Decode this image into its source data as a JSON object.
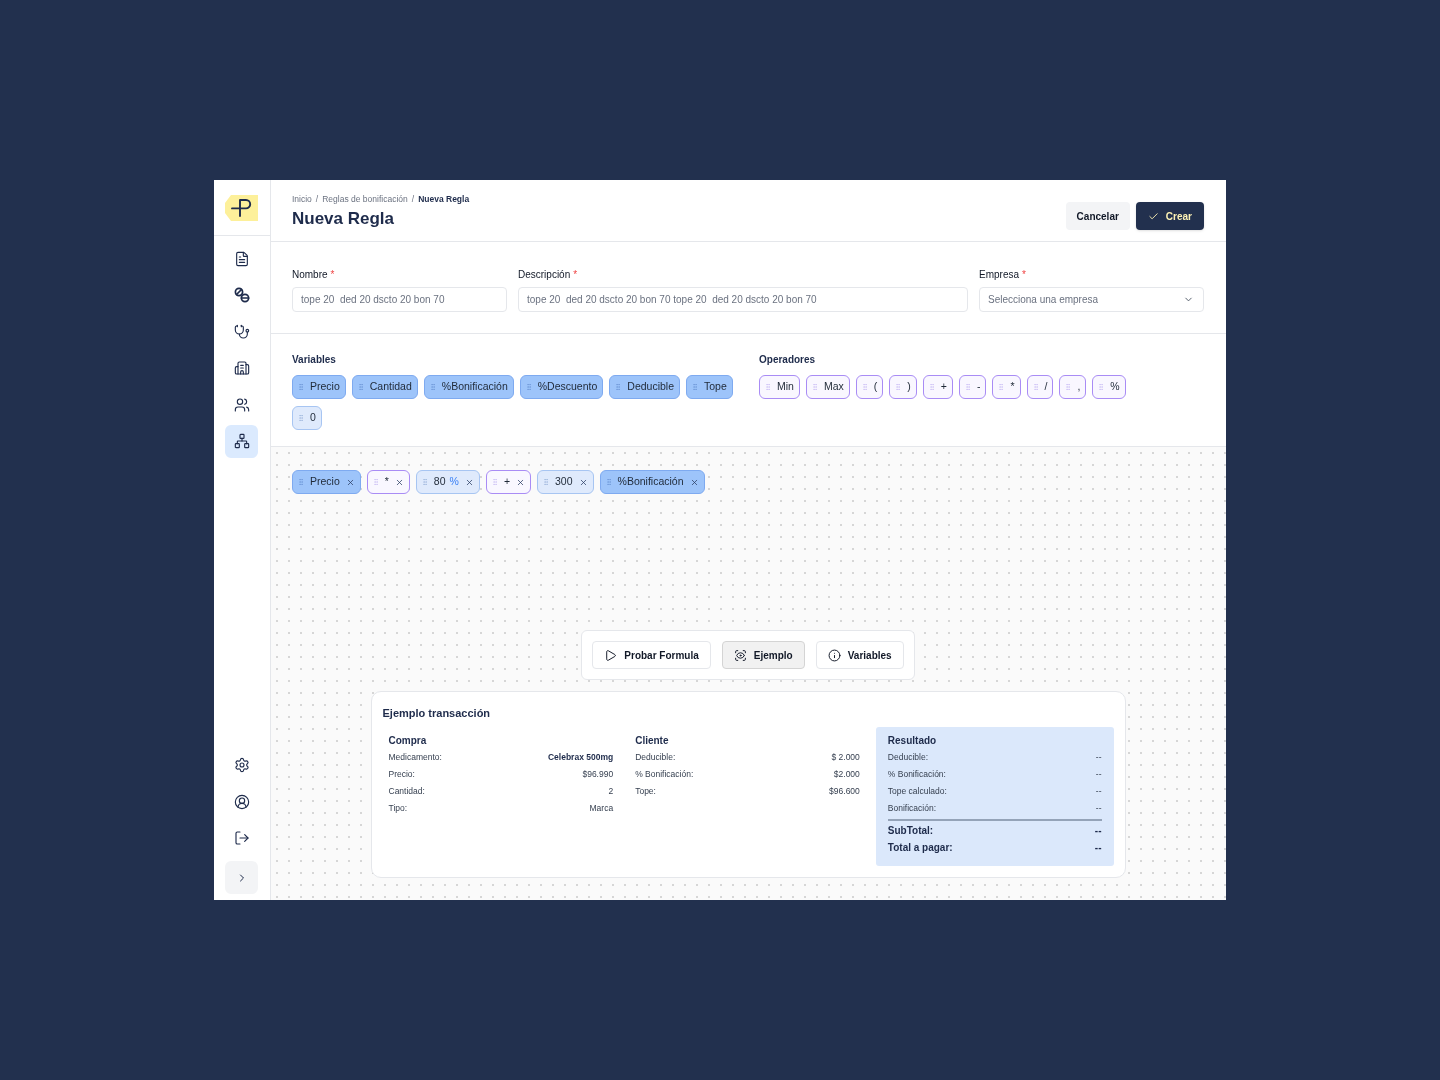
{
  "sidebar": {
    "items": [
      {
        "selected": false
      },
      {
        "selected": false
      },
      {
        "selected": false
      },
      {
        "selected": false
      },
      {
        "selected": false
      },
      {
        "selected": true
      }
    ]
  },
  "breadcrumb": {
    "separator": "/",
    "items": [
      {
        "label": "Inicio",
        "current": false
      },
      {
        "label": "Reglas de bonificación",
        "current": false
      },
      {
        "label": "Nueva Regla",
        "current": true
      }
    ]
  },
  "title": "Nueva Regla",
  "actions": [
    {
      "label": "Cancelar",
      "kind": "secondary"
    },
    {
      "label": "Crear",
      "kind": "primary"
    }
  ],
  "form": {
    "required_mark": "*",
    "fields": [
      {
        "label": "Nombre",
        "required": true,
        "kind": "text",
        "placeholder": "tope 20  ded 20 dscto 20 bon 70"
      },
      {
        "label": "Descripción",
        "required": true,
        "kind": "text",
        "placeholder": "tope 20  ded 20 dscto 20 bon 70 tope 20  ded 20 dscto 20 bon 70"
      },
      {
        "label": "Empresa",
        "required": true,
        "kind": "select",
        "placeholder": "Selecciona una empresa"
      }
    ]
  },
  "variables": {
    "title": "Variables",
    "items": [
      {
        "label": "Precio",
        "kind": "variable"
      },
      {
        "label": "Cantidad",
        "kind": "variable"
      },
      {
        "label": "%Bonificación",
        "kind": "variable"
      },
      {
        "label": "%Descuento",
        "kind": "variable"
      },
      {
        "label": "Deducible",
        "kind": "variable"
      },
      {
        "label": "Tope",
        "kind": "variable"
      },
      {
        "label": "0",
        "kind": "number"
      }
    ]
  },
  "operators": {
    "title": "Operadores",
    "items": [
      {
        "label": "Min",
        "kind": "operator"
      },
      {
        "label": "Max",
        "kind": "operator"
      },
      {
        "label": "(",
        "kind": "operator"
      },
      {
        "label": ")",
        "kind": "operator"
      },
      {
        "label": "+",
        "kind": "operator"
      },
      {
        "label": "-",
        "kind": "operator"
      },
      {
        "label": "*",
        "kind": "operator"
      },
      {
        "label": "/",
        "kind": "operator"
      },
      {
        "label": ",",
        "kind": "operator"
      },
      {
        "label": "%",
        "kind": "operator"
      }
    ]
  },
  "formula": {
    "tokens": [
      {
        "label": "Precio",
        "kind": "variable"
      },
      {
        "label": "*",
        "kind": "operator"
      },
      {
        "label": "80",
        "unit": "%",
        "kind": "number"
      },
      {
        "label": "+",
        "kind": "operator"
      },
      {
        "label": "300",
        "kind": "number"
      },
      {
        "label": "%Bonificación",
        "kind": "variable"
      }
    ]
  },
  "toolbar": {
    "buttons": [
      {
        "label": "Probar Formula",
        "selected": false
      },
      {
        "label": "Ejemplo",
        "selected": true
      },
      {
        "label": "Variables",
        "selected": false
      }
    ]
  },
  "example": {
    "title": "Ejemplo transacción",
    "sections": [
      {
        "title": "Compra",
        "rows": [
          {
            "label": "Medicamento:",
            "value": "Celebrax 500mg",
            "bold": true
          },
          {
            "label": "Precio:",
            "value": "$96.990",
            "bold": false
          },
          {
            "label": "Cantidad:",
            "value": "2",
            "bold": false
          },
          {
            "label": "Tipo:",
            "value": "Marca",
            "bold": false
          }
        ]
      },
      {
        "title": "Cliente",
        "rows": [
          {
            "label": "Deducible:",
            "value": "$ 2.000",
            "bold": false
          },
          {
            "label": "% Bonificación:",
            "value": "$2.000",
            "bold": false
          },
          {
            "label": "Tope:",
            "value": "$96.600",
            "bold": false
          }
        ]
      }
    ],
    "result": {
      "title": "Resultado",
      "rows": [
        {
          "label": "Deducible:",
          "value": "--"
        },
        {
          "label": "% Bonificación:",
          "value": "--"
        },
        {
          "label": "Tope calculado:",
          "value": "--"
        },
        {
          "label": "Bonificación:",
          "value": "--"
        }
      ],
      "totals": [
        {
          "label": "SubTotal:",
          "value": "--"
        },
        {
          "label": "Total a pagar:",
          "value": "--"
        }
      ]
    }
  }
}
